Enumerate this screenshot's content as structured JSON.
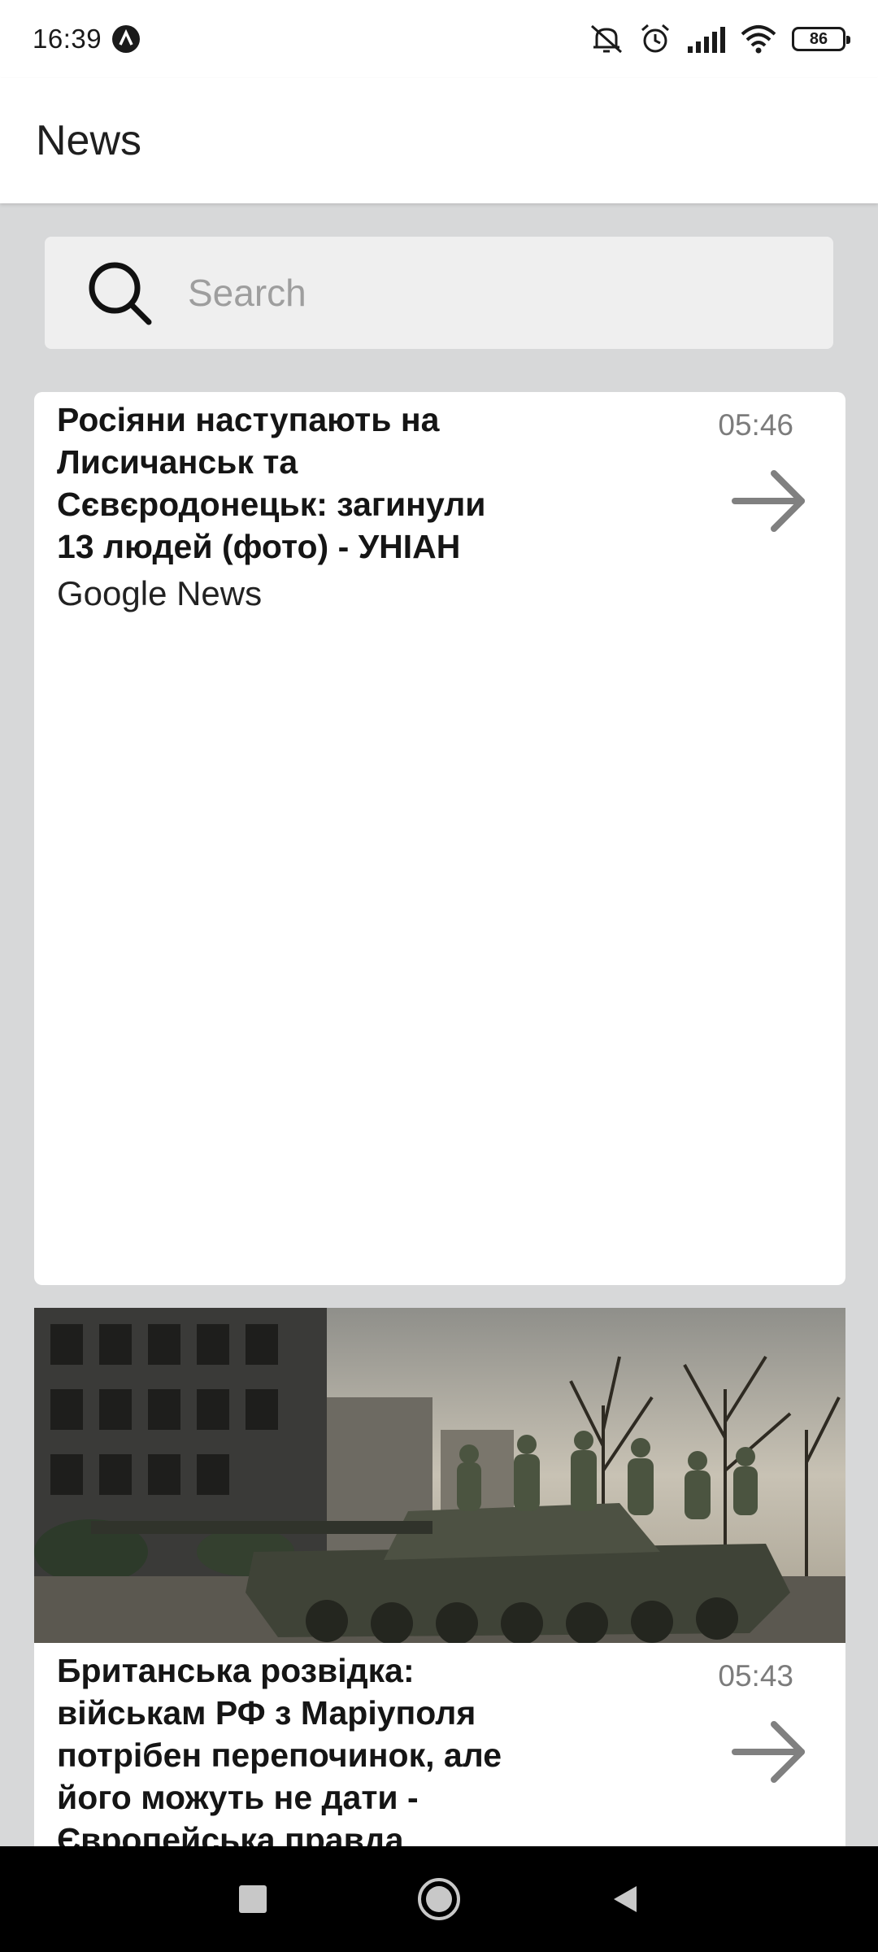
{
  "status_bar": {
    "time": "16:39",
    "battery": "86",
    "icons": [
      "notification-a-icon",
      "mute-icon",
      "alarm-icon",
      "signal-icon",
      "wifi-icon",
      "battery-icon"
    ]
  },
  "app_bar": {
    "title": "News"
  },
  "search": {
    "placeholder": "Search",
    "value": ""
  },
  "articles": [
    {
      "headline": "Росіяни наступають на Лисичанськ та Сєвєродонецьк: загинули 13 людей (фото) - УНІАН",
      "source": "Google News",
      "time": "05:46",
      "has_image": false
    },
    {
      "headline": "Британська розвідка: військам РФ з Маріуполя потрібен перепочинок, але його можуть не дати - Європейська правда",
      "source": "",
      "time": "05:43",
      "has_image": true,
      "image_icon": "tank-photo"
    }
  ],
  "nav_bar": {
    "icons": [
      "recents-square-icon",
      "home-circle-icon",
      "back-triangle-icon"
    ]
  },
  "colors": {
    "background": "#d7d8d9",
    "card": "#ffffff",
    "search_bg": "#efefef",
    "arrow": "#808080"
  }
}
